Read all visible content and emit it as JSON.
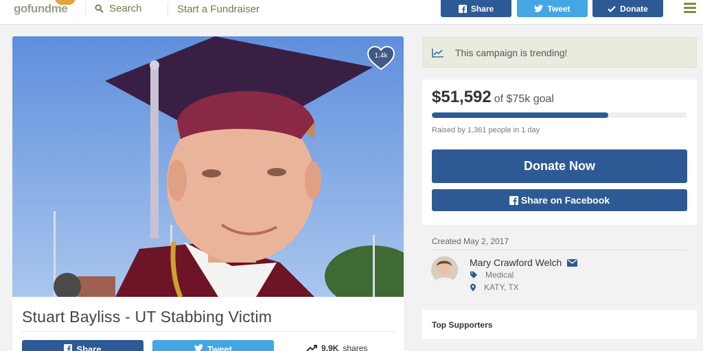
{
  "header": {
    "logo": "gofundme",
    "search_label": "Search",
    "start_label": "Start a Fundraiser",
    "share_label": "Share",
    "tweet_label": "Tweet",
    "donate_label": "Donate"
  },
  "campaign": {
    "title": "Stuart Bayliss - UT Stabbing Victim",
    "heart_count": "1.4k",
    "share_label": "Share",
    "tweet_label": "Tweet",
    "shares_count": "9.9K",
    "shares_label": "shares"
  },
  "sidebar": {
    "trending": "This campaign is trending!",
    "amount": "$51,592",
    "goal": "of $75k goal",
    "progress": 0.69,
    "raised_text": "Raised by 1,361 people in 1 day",
    "donate_now": "Donate Now",
    "share_facebook": "Share on Facebook",
    "created": "Created May 2, 2017",
    "organizer_name": "Mary Crawford Welch",
    "category": "Medical",
    "location": "KATY, TX",
    "top_supporters": "Top Supporters"
  },
  "colors": {
    "facebook_blue": "#2d5a95",
    "twitter_blue": "#45a6e4",
    "accent_green": "#6a7d4a",
    "trend_bg": "#e8ecde"
  },
  "icons": [
    "search-icon",
    "facebook-icon",
    "twitter-icon",
    "check-icon",
    "menu-icon",
    "heart-icon",
    "trending-icon",
    "mail-icon",
    "tag-icon",
    "location-icon"
  ]
}
